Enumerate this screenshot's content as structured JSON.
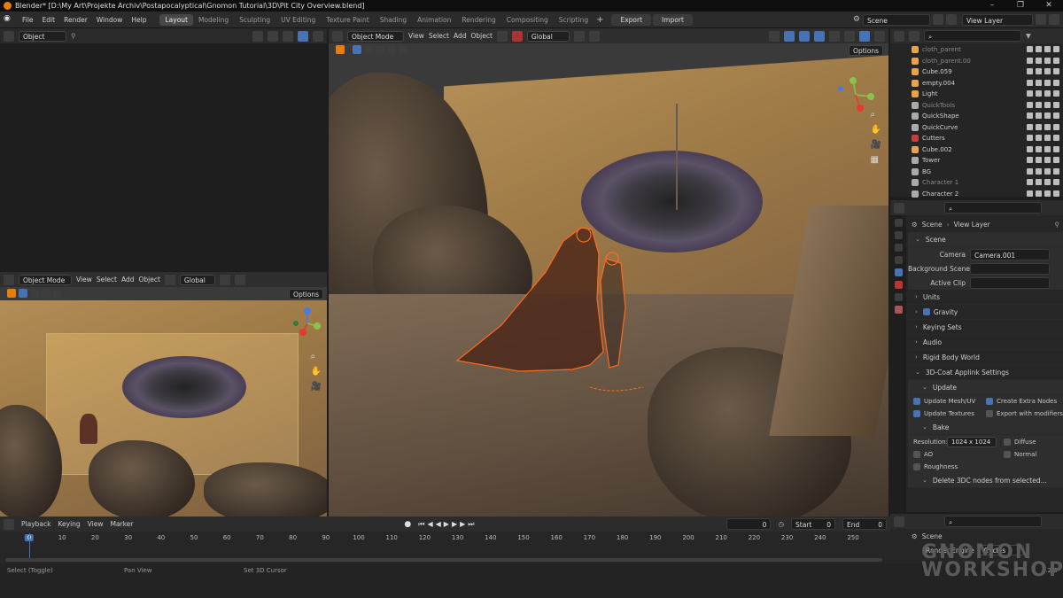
{
  "window": {
    "title": "Blender* [D:\\My Art\\Projekte Archiv\\Postapocalyptical\\Gnomon Tutorial\\3D\\Pit City Overview.blend]"
  },
  "menu": [
    "File",
    "Edit",
    "Render",
    "Window",
    "Help"
  ],
  "workspaces": [
    "Layout",
    "Modeling",
    "Sculpting",
    "UV Editing",
    "Texture Paint",
    "Shading",
    "Animation",
    "Rendering",
    "Compositing",
    "Scripting"
  ],
  "topbar": {
    "export": "Export",
    "import": "Import",
    "scene": "Scene",
    "view_layer": "View Layer"
  },
  "left_top_header": {
    "mode": "Object"
  },
  "left_vp_header": {
    "mode": "Object Mode",
    "view": "View",
    "select": "Select",
    "add": "Add",
    "object": "Object",
    "orientation": "Global",
    "options": "Options"
  },
  "main_vp_header": {
    "mode": "Object Mode",
    "view": "View",
    "select": "Select",
    "add": "Add",
    "object": "Object",
    "orientation": "Global",
    "options": "Options"
  },
  "outliner": {
    "items": [
      {
        "label": "cloth_parent",
        "color": "#e8a24a",
        "dim": true
      },
      {
        "label": "cloth_parent.00",
        "color": "#e8a24a",
        "dim": true
      },
      {
        "label": "Cube.059",
        "color": "#e8a24a",
        "dim": false
      },
      {
        "label": "empty.004",
        "color": "#e8a24a",
        "dim": false
      },
      {
        "label": "Light",
        "color": "#e8a24a",
        "dim": false
      },
      {
        "label": "QuickTools",
        "color": "#aaaaaa",
        "dim": true
      },
      {
        "label": "QuickShape",
        "color": "#aaaaaa",
        "dim": false
      },
      {
        "label": "QuickCurve",
        "color": "#aaaaaa",
        "dim": false
      },
      {
        "label": "Cutters",
        "color": "#cc3b3b",
        "dim": false
      },
      {
        "label": "Cube.002",
        "color": "#e8a24a",
        "dim": false
      },
      {
        "label": "Tower",
        "color": "#aaaaaa",
        "dim": false
      },
      {
        "label": "BG",
        "color": "#aaaaaa",
        "dim": false
      },
      {
        "label": "Character 1",
        "color": "#aaaaaa",
        "dim": true
      },
      {
        "label": "Character 2",
        "color": "#aaaaaa",
        "dim": false
      }
    ]
  },
  "properties": {
    "breadcrumb_scene": "Scene",
    "breadcrumb_layer": "View Layer",
    "section_scene": "Scene",
    "camera_label": "Camera",
    "camera_value": "Camera.001",
    "bg_scene_label": "Background Scene",
    "active_clip_label": "Active Clip",
    "units": "Units",
    "gravity": "Gravity",
    "keying_sets": "Keying Sets",
    "audio": "Audio",
    "rigid_body": "Rigid Body World",
    "applink": "3D-Coat Applink Settings",
    "update": "Update",
    "update_mesh": "Update Mesh/UV",
    "create_extra": "Create Extra Nodes",
    "update_textures": "Update Textures",
    "export_mod": "Export with modifiers",
    "bake": "Bake",
    "resolution_label": "Resolution:",
    "resolution_value": "1024 x 1024",
    "diffuse": "Diffuse",
    "ao": "AO",
    "normal": "Normal",
    "roughness": "Roughness",
    "delete_nodes": "Delete 3DC nodes from selected..."
  },
  "render_props": {
    "scene": "Scene",
    "engine_label": "Render Engine",
    "engine_value": "Cycles"
  },
  "timeline": {
    "playback": "Playback",
    "keying": "Keying",
    "view": "View",
    "marker": "Marker",
    "current_frame": "0",
    "start_label": "Start",
    "start": "0",
    "end_label": "End",
    "end": "0",
    "ticks": [
      "0",
      "10",
      "20",
      "30",
      "40",
      "50",
      "60",
      "70",
      "80",
      "90",
      "100",
      "110",
      "120",
      "130",
      "140",
      "150",
      "160",
      "170",
      "180",
      "190",
      "200",
      "210",
      "220",
      "230",
      "240",
      "250"
    ]
  },
  "status": {
    "select": "Select (Toggle)",
    "pan": "Pan View",
    "cursor": "Set 3D Cursor",
    "version": "3.2.0"
  },
  "watermark": {
    "line1": "GNOMON",
    "line2": "WORKSHOP"
  },
  "colors": {
    "accent": "#4772b3",
    "selection": "#ff6a1a",
    "orange": "#e87d0d"
  }
}
